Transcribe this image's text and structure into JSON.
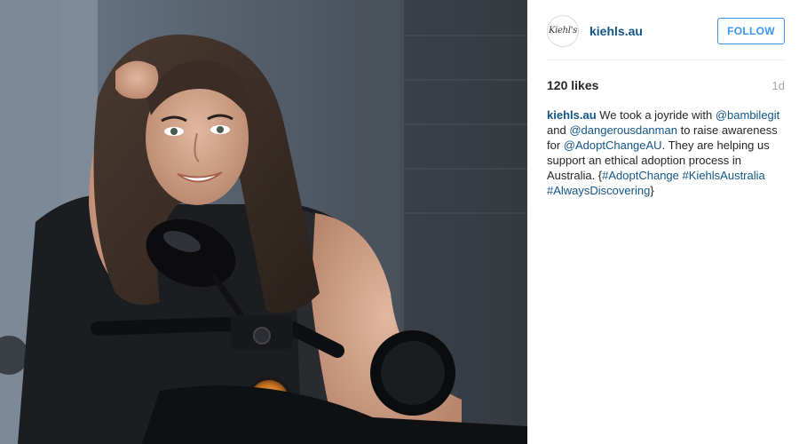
{
  "post": {
    "account": {
      "username": "kiehls.au",
      "avatar_text": "Kiehl's"
    },
    "follow_label": "FOLLOW",
    "likes": "120 likes",
    "time_ago": "1d",
    "caption": {
      "username": "kiehls.au",
      "part1": "We took a joyride with",
      "mention1": "@bambilegit",
      "part2": "and",
      "mention2": "@dangerousdanman",
      "part3": "to raise awareness for",
      "mention3": "@AdoptChangeAU",
      "part4": ". They are helping us support an ethical adoption process in Australia. {",
      "hashtag1": "#AdoptChange",
      "hashtag2": "#KiehlsAustralia",
      "hashtag3": "#AlwaysDiscovering",
      "part5": "}"
    }
  },
  "colors": {
    "link": "#125688",
    "follow_accent": "#3897f0",
    "muted": "#a5a7aa",
    "text": "#262626"
  },
  "icons": {
    "photo": "post-photo"
  }
}
